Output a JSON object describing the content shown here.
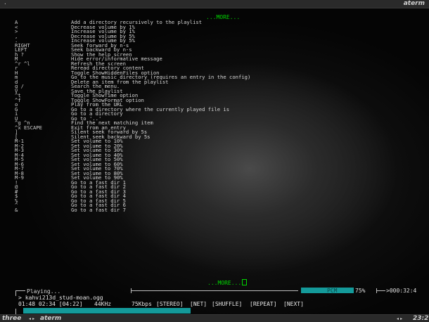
{
  "titlebar": {
    "dot": "·",
    "title": "aterm"
  },
  "help": {
    "more_top": "...MORE...",
    "more_bottom": "...MORE...",
    "items": [
      {
        "key": "A",
        "desc": "Add a directory recursively to the playlist"
      },
      {
        "key": "<",
        "desc": "Decrease volume by 1%"
      },
      {
        "key": ">",
        "desc": "Increase volume by 1%"
      },
      {
        "key": ",",
        "desc": "Decrease volume by 5%"
      },
      {
        "key": ".",
        "desc": "Increase volume by 5%"
      },
      {
        "key": "RIGHT",
        "desc": "Seek forward by n-s"
      },
      {
        "key": "LEFT",
        "desc": "Seek backward by n-s"
      },
      {
        "key": "h ?",
        "desc": "Show the help screen"
      },
      {
        "key": "M",
        "desc": "Hide error/informative message"
      },
      {
        "key": "^r ^l",
        "desc": "Refresh the screen"
      },
      {
        "key": "r",
        "desc": "Reread directory content"
      },
      {
        "key": "H",
        "desc": "Toggle ShowHiddenFiles option"
      },
      {
        "key": "m",
        "desc": "Go to the music directory (requires an entry in the config)"
      },
      {
        "key": "d",
        "desc": "Delete an item from the playlist"
      },
      {
        "key": "g /",
        "desc": "Search the menu."
      },
      {
        "key": "V",
        "desc": "Save the playlist"
      },
      {
        "key": "^t",
        "desc": "Toggle ShowTime option"
      },
      {
        "key": "^f",
        "desc": "Toggle ShowFormat option"
      },
      {
        "key": "o",
        "desc": "Play from the URL"
      },
      {
        "key": "G",
        "desc": "Go to a directory where the currently played file is"
      },
      {
        "key": "i",
        "desc": "Go to a directory"
      },
      {
        "key": "U",
        "desc": "Go to '..'"
      },
      {
        "key": "^g ^n",
        "desc": "Find the next matching item"
      },
      {
        "key": "^x ESCAPE",
        "desc": "Exit from an entry"
      },
      {
        "key": "]",
        "desc": "Silent seek forward by 5s"
      },
      {
        "key": "[",
        "desc": "Silent seek backward by 5s"
      },
      {
        "key": "M-1",
        "desc": "Set volume to 10%"
      },
      {
        "key": "M-2",
        "desc": "Set volume to 20%"
      },
      {
        "key": "M-3",
        "desc": "Set volume to 30%"
      },
      {
        "key": "M-4",
        "desc": "Set volume to 40%"
      },
      {
        "key": "M-5",
        "desc": "Set volume to 50%"
      },
      {
        "key": "M-6",
        "desc": "Set volume to 60%"
      },
      {
        "key": "M-7",
        "desc": "Set volume to 70%"
      },
      {
        "key": "M-8",
        "desc": "Set volume to 80%"
      },
      {
        "key": "M-9",
        "desc": "Set volume to 90%"
      },
      {
        "key": "!",
        "desc": "Go to a fast dir 1"
      },
      {
        "key": "@",
        "desc": "Go to a fast dir 2"
      },
      {
        "key": "#",
        "desc": "Go to a fast dir 3"
      },
      {
        "key": "$",
        "desc": "Go to a fast dir 4"
      },
      {
        "key": "%",
        "desc": "Go to a fast dir 5"
      },
      {
        "key": "^",
        "desc": "Go to a fast dir 6"
      },
      {
        "key": "&",
        "desc": "Go to a fast dir 7"
      }
    ]
  },
  "player": {
    "status": "Playing...",
    "file_arrow": ">",
    "file": "kahvi213d_stud-moan.ogg",
    "time": "01:48 02:34 [04:22]",
    "rate": "44KHz",
    "bitrate": "75Kbps",
    "stereo": "[STEREO]",
    "net": "[NET]",
    "shuffle": "[SHUFFLE]",
    "repeat": "[REPEAT]",
    "next": "[NEXT]",
    "mixer_name": "PCM",
    "mixer_value": "75%",
    "mixer_level": 0.75,
    "total_time": ">000:32:4",
    "progress": 0.41
  },
  "taskbar": {
    "workspace": "three",
    "nav_arrows": "◂ ▸",
    "app": "aterm",
    "nav_arrows_right": "◂ ▸",
    "clock": "23:2"
  },
  "colors": {
    "accent_teal": "#149a9a",
    "more_green": "#00d600",
    "option_off_blue": "#2a2ad0"
  }
}
